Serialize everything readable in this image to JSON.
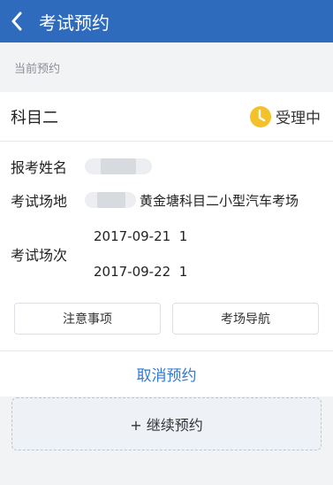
{
  "header": {
    "title": "考试预约",
    "back_icon": "chevron-left-icon"
  },
  "section": {
    "label": "当前预约"
  },
  "booking": {
    "subject": "科目二",
    "status": {
      "icon": "clock-icon",
      "text": "受理中",
      "color": "#f5c12b"
    },
    "name_label": "报考姓名",
    "venue_label": "考试场地",
    "venue_text": "黄金塘科目二小型汽车考场",
    "session_label": "考试场次",
    "sessions": [
      "2017-09-21  1",
      "2017-09-22  1"
    ]
  },
  "actions": {
    "notice": "注意事项",
    "navigation": "考场导航",
    "cancel": "取消预约",
    "continue": "+ 继续预约"
  },
  "colors": {
    "header_bg": "#2f6bbd",
    "accent_link": "#2f7ad6"
  }
}
